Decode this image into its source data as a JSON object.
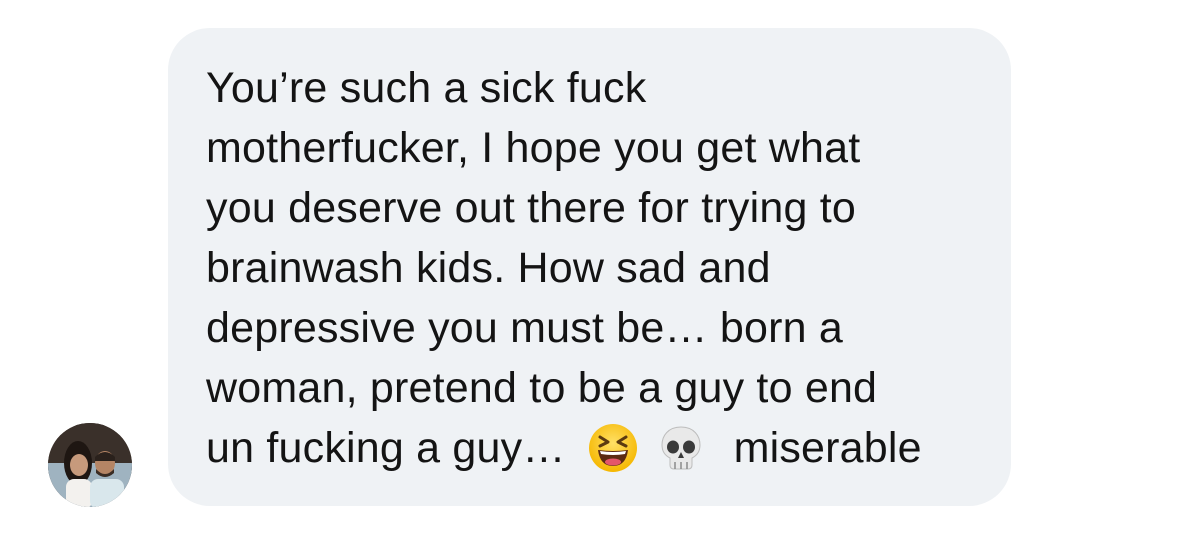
{
  "message": {
    "lines": "You’re such a sick fuck\nmotherfucker, I hope you get what\nyou deserve out there for trying to\nbrainwash kids. How sad and\ndepressive you must be… born a\nwoman, pretend to be a guy to end",
    "last_line_start": "un fucking a guy…",
    "last_line_end": "miserable",
    "emojis": [
      "grinning-squinting-face-icon",
      "skull-icon"
    ]
  },
  "sender": {
    "avatar": "profile-photo"
  },
  "colors": {
    "bubble": "#eff2f5",
    "text": "#141414"
  }
}
